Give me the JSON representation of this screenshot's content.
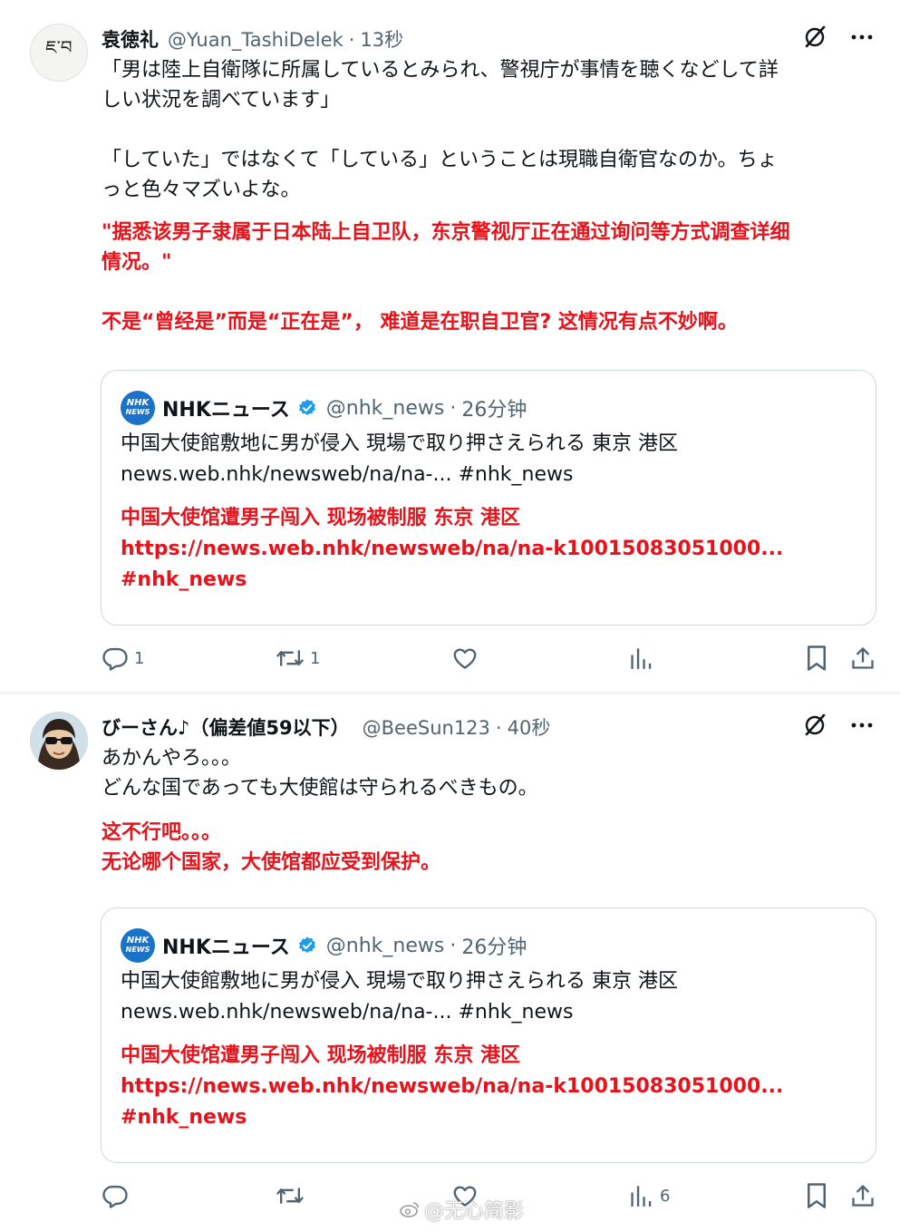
{
  "tweets": [
    {
      "display_name": "袁徳礼",
      "handle": "@Yuan_TashiDelek",
      "time": "13秒",
      "text": "「男は陸上自衛隊に所属しているとみられ、警視庁が事情を聴くなどして詳\nしい状況を調べています」\n\n「していた」ではなくて「している」ということは現職自衛官なのか。ちょ\nっと色々マズいよな。",
      "translation": "\"据悉该男子隶属于日本陆上自卫队，东京警视厅正在通过询问等方式调查详细\n情况。\"\n\n不是“曾经是”而是“正在是”， 难道是在职自卫官? 这情况有点不妙啊。",
      "avatar_text": "ཇ་བ",
      "quote": {
        "logo_top": "NHK",
        "logo_bottom": "NEWS",
        "name": "NHKニュース",
        "handle": "@nhk_news",
        "time": "26分钟",
        "text": "中国大使館敷地に男が侵入 現場で取り押さえられる 東京 港区\nnews.web.nhk/newsweb/na/na-... #nhk_news",
        "translation": "中国大使馆遭男子闯入 现场被制服 东京 港区\nhttps://news.web.nhk/newsweb/na/na-k10015083051000...\n#nhk_news"
      },
      "reply_count": "1",
      "repost_count": "1",
      "like_count": "",
      "view_count": ""
    },
    {
      "display_name": "びーさん♪（偏差値59以下）",
      "handle": "@BeeSun123",
      "time": "40秒",
      "text": "あかんやろ。。。\nどんな国であっても大使館は守られるべきもの。",
      "translation": "这不行吧。。。\n无论哪个国家，大使馆都应受到保护。",
      "quote": {
        "logo_top": "NHK",
        "logo_bottom": "NEWS",
        "name": "NHKニュース",
        "handle": "@nhk_news",
        "time": "26分钟",
        "text": "中国大使館敷地に男が侵入 現場で取り押さえられる 東京 港区\nnews.web.nhk/newsweb/na/na-... #nhk_news",
        "translation": "中国大使馆遭男子闯入 现场被制服 东京 港区\nhttps://news.web.nhk/newsweb/na/na-k10015083051000...\n#nhk_news"
      },
      "reply_count": "",
      "repost_count": "",
      "like_count": "",
      "view_count": "6"
    }
  ],
  "separator": "·",
  "watermark": "@无心简影",
  "colors": {
    "translation_red": "#e8121b",
    "secondary_text": "#536471",
    "verified_blue": "#1d9bf0",
    "nhk_blue": "#1b73c9"
  },
  "icons": {
    "grok": "grok-icon",
    "more": "more-icon",
    "reply": "reply-icon",
    "repost": "repost-icon",
    "like": "like-icon",
    "views": "views-icon",
    "bookmark": "bookmark-icon",
    "share": "share-icon",
    "verified": "verified-badge-icon"
  }
}
